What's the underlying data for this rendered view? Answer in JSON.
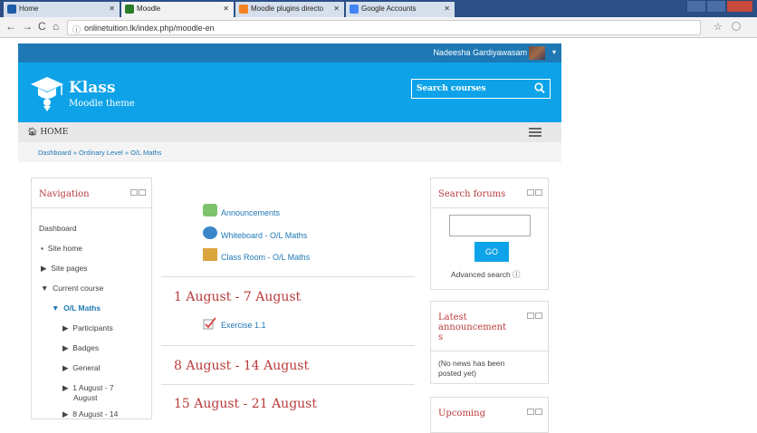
{
  "browser": {
    "tabs": [
      {
        "title": "Home",
        "color": "#1e5ca8"
      },
      {
        "title": "Moodle",
        "color": "#2a7d2a"
      },
      {
        "title": "Moodle plugins directo",
        "color": "#f58220"
      },
      {
        "title": "Google Accounts",
        "color": "#4285f4"
      }
    ],
    "url": "onlinetuition.lk/index.php/moodle-en"
  },
  "site": {
    "username": "Nadeesha Gardiyawasam",
    "brand": "Klass",
    "tagline": "Moodle theme",
    "search_placeholder": "Search courses",
    "home_label": "HOME",
    "breadcrumb": "Dashboard  »  Ordinary Level  »  O/L Maths"
  },
  "navigation": {
    "title": "Navigation",
    "items": [
      {
        "label": "Dashboard",
        "marker": ""
      },
      {
        "label": "Site home",
        "marker": "▪"
      },
      {
        "label": "Site pages",
        "marker": "▶"
      },
      {
        "label": "Current course",
        "marker": "▼"
      },
      {
        "label": "O/L Maths",
        "marker": "▼"
      },
      {
        "label": "Participants",
        "marker": "▶"
      },
      {
        "label": "Badges",
        "marker": "▶"
      },
      {
        "label": "General",
        "marker": "▶"
      },
      {
        "label": "1 August - 7",
        "marker": "▶"
      },
      {
        "label": "August",
        "marker": ""
      },
      {
        "label": "8 August - 14",
        "marker": "▶"
      }
    ]
  },
  "course": {
    "top_activities": [
      "Announcements",
      "Whiteboard - O/L Maths",
      "Class Room - O/L Maths"
    ],
    "sections": [
      {
        "title": "1 August - 7 August",
        "activity": "Exercise 1.1"
      },
      {
        "title": "8 August - 14 August"
      },
      {
        "title": "15 August - 21 August"
      }
    ]
  },
  "search_forums": {
    "title": "Search forums",
    "go_label": "GO",
    "advanced": "Advanced search ⓘ"
  },
  "latest": {
    "title_line1": "Latest",
    "title_line2": "announcement",
    "title_line3": "s",
    "body_line1": "(No news has been",
    "body_line2": "posted yet)"
  },
  "upcoming": {
    "title": "Upcoming"
  }
}
